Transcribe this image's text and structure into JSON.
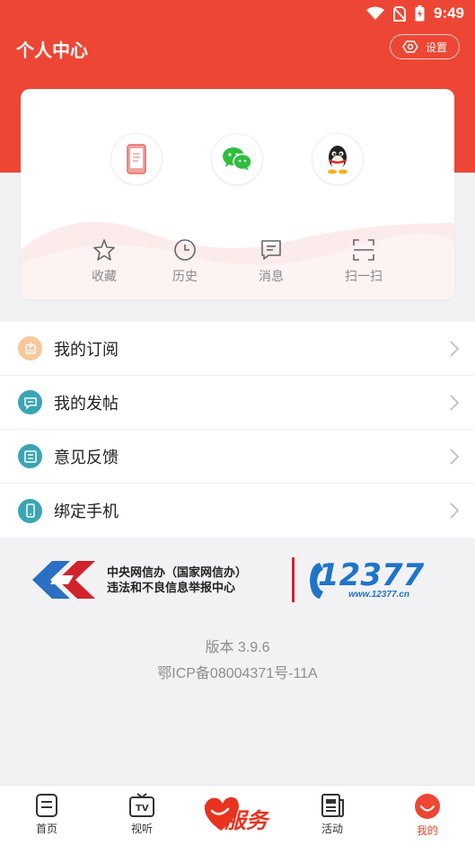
{
  "status_bar": {
    "time": "9:49"
  },
  "header": {
    "title": "个人中心",
    "settings_label": "设置"
  },
  "quick_actions": [
    {
      "label": "收藏",
      "icon": "star-icon"
    },
    {
      "label": "历史",
      "icon": "clock-icon"
    },
    {
      "label": "消息",
      "icon": "message-icon"
    },
    {
      "label": "扫一扫",
      "icon": "scan-icon"
    }
  ],
  "menu": [
    {
      "label": "我的订阅",
      "icon": "subscribe-icon",
      "color": "#f2a160"
    },
    {
      "label": "我的发帖",
      "icon": "post-icon",
      "color": "#3aa5b5"
    },
    {
      "label": "意见反馈",
      "icon": "feedback-icon",
      "color": "#3aa5b5"
    },
    {
      "label": "绑定手机",
      "icon": "phone-icon",
      "color": "#3aa5b5"
    }
  ],
  "report": {
    "line1": "中央网信办（国家网信办）",
    "line2": "违法和不良信息举报中心",
    "number": "12377",
    "url": "www.12377.cn"
  },
  "footer": {
    "version": "版本 3.9.6",
    "icp": "鄂ICP备08004371号-11A"
  },
  "tabs": [
    {
      "label": "首页",
      "icon": "home-doc-icon"
    },
    {
      "label": "视听",
      "icon": "tv-icon"
    },
    {
      "label": "服务",
      "icon": "service-heart-icon"
    },
    {
      "label": "活动",
      "icon": "news-icon"
    },
    {
      "label": "我的",
      "icon": "profile-icon"
    }
  ],
  "colors": {
    "brand_red": "#ee4634",
    "teal": "#3aa5b5",
    "orange": "#f2a160",
    "report_blue": "#1f74c9"
  }
}
